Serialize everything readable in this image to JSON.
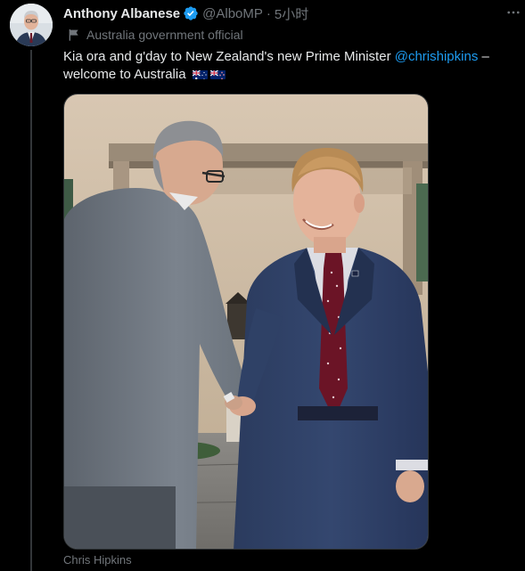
{
  "tweet": {
    "author": {
      "display_name": "Anthony Albanese",
      "handle": "@AlboMP",
      "verified": true,
      "verified_color": "#1d9bf0",
      "avatar_icon": "avatar-photo"
    },
    "separator": "·",
    "time": "5小时",
    "label": {
      "icon": "flag-icon",
      "text": "Australia government official"
    },
    "more_icon": "more-horizontal-icon",
    "text": {
      "line1_prefix": "Kia ora and g'day to New Zealand's new Prime Minister ",
      "mention": "@chrishipkins",
      "line1_suffix": " –",
      "line2": "welcome to Australia"
    },
    "emoji_flags": [
      "australia-flag",
      "new-zealand-flag"
    ],
    "media": {
      "type": "photo",
      "icon": "photo-handshake"
    },
    "media_caption": "Chris Hipkins"
  },
  "colors": {
    "background": "#000000",
    "text": "#e7e9ea",
    "secondary_text": "#71767b",
    "link": "#1d9bf0",
    "border": "#2f3336"
  }
}
